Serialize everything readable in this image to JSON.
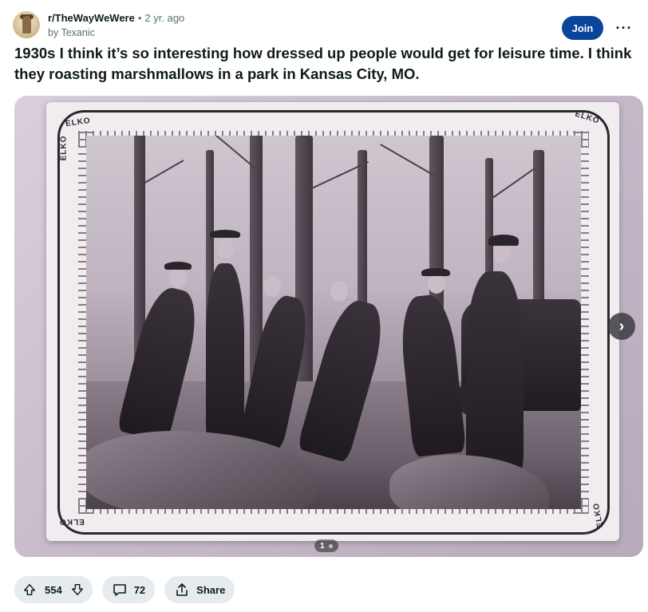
{
  "post": {
    "subreddit": "r/TheWayWeWere",
    "separator": "•",
    "time_ago": "2 yr. ago",
    "author_line": "by Texanic",
    "join_label": "Join",
    "more_label": "···",
    "title": "1930s I think it’s so interesting how dressed up people would get for leisure time. I think they roasting marshmallows in a park in Kansas City, MO."
  },
  "media": {
    "brand_text": "ELKO",
    "next_label": "›",
    "page_indicator": "1"
  },
  "actions": {
    "upvotes": "554",
    "comments": "72",
    "share_label": "Share"
  },
  "colors": {
    "join_button": "#0a449b",
    "action_pill_bg": "#e5ebee",
    "text_primary": "#0f1a1c",
    "text_secondary": "#576f76"
  }
}
